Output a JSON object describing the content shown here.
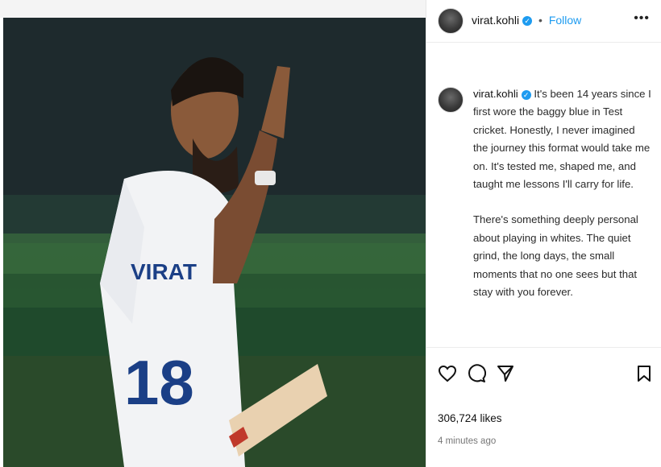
{
  "post": {
    "username": "virat.kohli",
    "follow_label": "Follow",
    "dot": "•",
    "more_label": "•••",
    "caption_paragraphs": [
      "It's been 14 years since I first wore the baggy blue in Test cricket. Honestly, I never imagined the journey this format would take me on. It's tested me, shaped me, and taught me lessons I'll carry for life.",
      "There's something deeply personal about playing in whites. The quiet grind, the long days, the small moments that no one sees but that stay with you forever."
    ],
    "likes": "306,724 likes",
    "time": "4 minutes ago",
    "jersey_name": "VIRAT",
    "jersey_number": "18"
  },
  "icons": {
    "like": "heart-icon",
    "comment": "comment-icon",
    "share": "send-icon",
    "save": "bookmark-icon",
    "verified": "verified-badge-icon"
  },
  "colors": {
    "link": "#1d9bf0",
    "text": "#111111",
    "muted": "#777777"
  }
}
